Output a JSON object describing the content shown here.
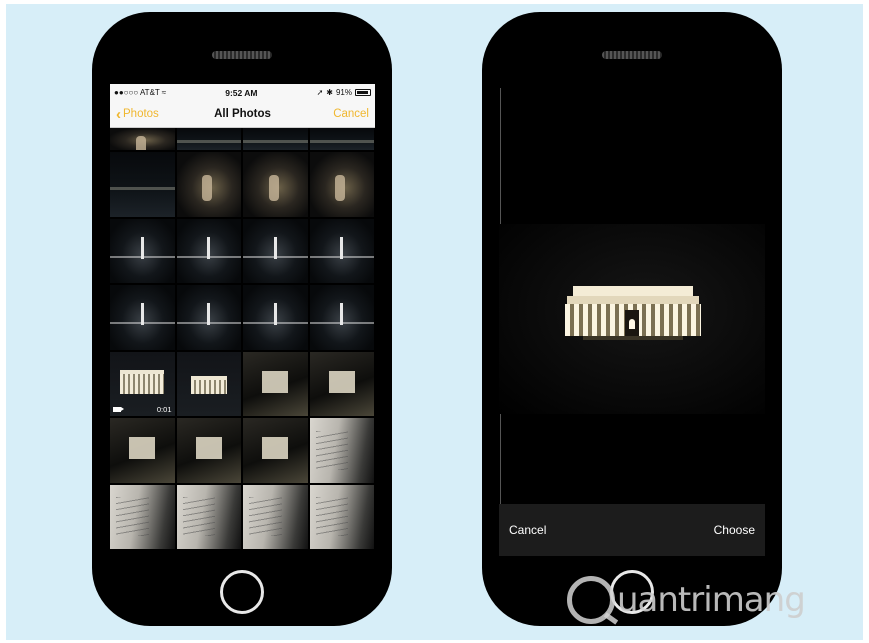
{
  "left_phone": {
    "status_bar": {
      "carrier": "●●○○○ AT&T",
      "time": "9:52 AM",
      "battery": "91%"
    },
    "nav": {
      "back_label": "Photos",
      "title": "All Photos",
      "cancel_label": "Cancel"
    },
    "grid": {
      "rows": [
        [
          "plaza",
          "night",
          "night",
          "night"
        ],
        [
          "night",
          "plaza",
          "plaza",
          "plaza"
        ],
        [
          "monument",
          "monument",
          "monument",
          "monument"
        ],
        [
          "monument",
          "monument",
          "monument",
          "monument"
        ],
        [
          "memorial",
          "memorial-small",
          "interior",
          "interior"
        ],
        [
          "interior",
          "interior",
          "interior",
          "wall"
        ],
        [
          "wall",
          "wall",
          "wall",
          "wall"
        ]
      ],
      "video_duration": "0:01"
    }
  },
  "right_phone": {
    "toolbar": {
      "cancel_label": "Cancel",
      "choose_label": "Choose"
    }
  },
  "watermark": {
    "text": "uantrimang"
  },
  "colors": {
    "accent": "#f0b72f",
    "background": "#d7eef8",
    "phone_body": "#000000"
  }
}
